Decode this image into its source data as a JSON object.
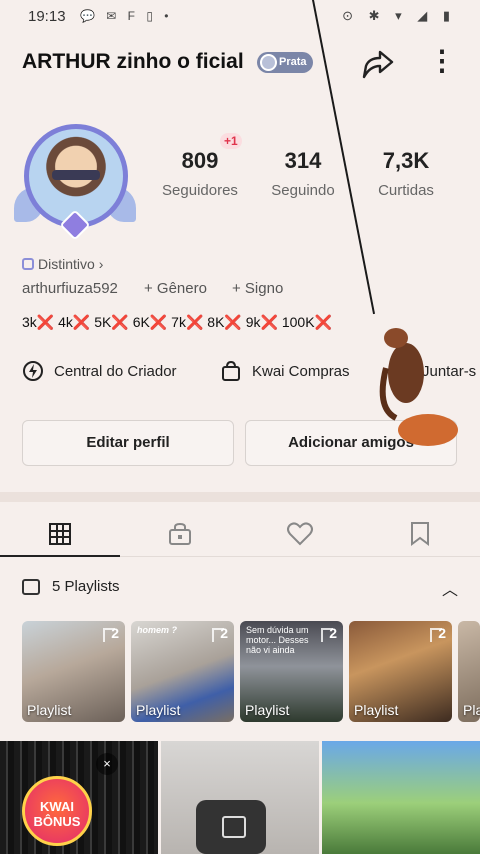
{
  "status_bar": {
    "time": "19:13",
    "left_icons": "💬 ✉ F ▯ •",
    "right_icons": "⊙ ✱ ▾ ◢ ▮"
  },
  "profile": {
    "name": "ARTHUR zinho o ficial",
    "tier_badge": "Prata",
    "stats": [
      {
        "value": "809",
        "label": "Seguidores"
      },
      {
        "value": "314",
        "label": "Seguindo"
      },
      {
        "value": "7,3K",
        "label": "Curtidas"
      }
    ],
    "new_followers": "+1",
    "distintivo": "Distintivo",
    "handle": "arthurfiuza592",
    "genero": "+ Gênero",
    "signo": "+ Signo",
    "bio_items": [
      "3k",
      "4k",
      "5K",
      "6K",
      "7k",
      "8K",
      "9k",
      "100K"
    ]
  },
  "shortcuts": [
    {
      "label": "Central do Criador",
      "icon": "lightning-icon"
    },
    {
      "label": "Kwai Compras",
      "icon": "shopping-bag-icon"
    },
    {
      "label": "Juntar-s",
      "icon": "group-icon"
    }
  ],
  "buttons": {
    "edit": "Editar perfil",
    "add": "Adicionar amigos"
  },
  "tabs": [
    "grid-icon",
    "lock-icon",
    "heart-icon",
    "bookmark-icon"
  ],
  "playlists": {
    "title": "5 Playlists",
    "items": [
      {
        "label": "Playlist",
        "count": "2",
        "caption": ""
      },
      {
        "label": "Playlist",
        "count": "2",
        "caption": "homem ?"
      },
      {
        "label": "Playlist",
        "count": "2",
        "caption": "Sem dúvida um motor... Desses não vi ainda"
      },
      {
        "label": "Playlist",
        "count": "2",
        "caption": ""
      },
      {
        "label": "Pla",
        "count": "",
        "caption": ""
      }
    ]
  },
  "grid": {
    "kwai_promo": "KWAI BÔNUS",
    "close": "×"
  },
  "colors": {
    "background": "#f6efec",
    "accent_red": "#e0302f",
    "badge": "#7b86a8"
  }
}
